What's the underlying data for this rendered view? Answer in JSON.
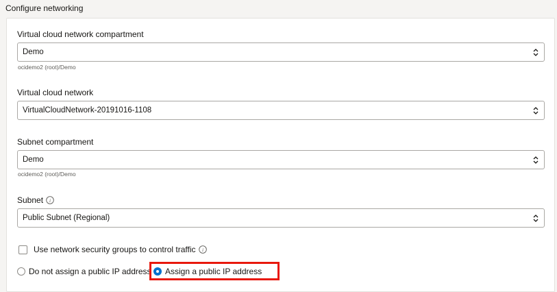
{
  "section": {
    "title": "Configure networking"
  },
  "vcn_compartment": {
    "label": "Virtual cloud network compartment",
    "value": "Demo",
    "hint": "ocidemo2 (root)/Demo"
  },
  "vcn": {
    "label": "Virtual cloud network",
    "value": "VirtualCloudNetwork-20191016-1108"
  },
  "subnet_compartment": {
    "label": "Subnet compartment",
    "value": "Demo",
    "hint": "ocidemo2 (root)/Demo"
  },
  "subnet": {
    "label": "Subnet",
    "value": "Public Subnet (Regional)"
  },
  "nsg": {
    "label": "Use network security groups to control traffic",
    "checked": false
  },
  "public_ip": {
    "options": [
      {
        "label": "Do not assign a public IP address",
        "selected": false
      },
      {
        "label": "Assign a public IP address",
        "selected": true
      }
    ]
  },
  "colors": {
    "accent": "#0572ce",
    "highlight": "#e8180c"
  }
}
